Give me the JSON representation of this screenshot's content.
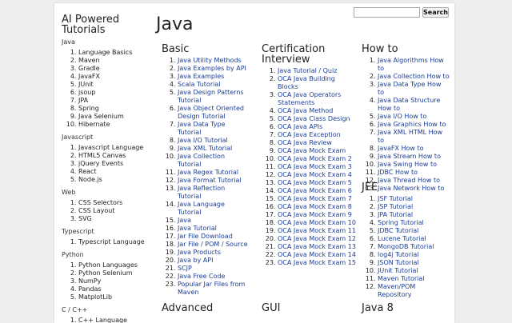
{
  "site_title": "AI Powered Tutorials",
  "page_title": "Java",
  "search": {
    "placeholder": "",
    "button_label": "Search"
  },
  "sidebar": {
    "sections": [
      {
        "title": "Java",
        "items": [
          "Language Basics",
          "Maven",
          "Gradle",
          "JavaFX",
          "JUnit",
          "jsoup",
          "JPA",
          "Spring",
          "Java Selenium",
          "Hibernate"
        ]
      },
      {
        "title": "Javascript",
        "items": [
          "Javascript Language",
          "HTML5 Canvas",
          "jQuery Events",
          "React",
          "Node.js"
        ]
      },
      {
        "title": "Web",
        "items": [
          "CSS Selectors",
          "CSS Layout",
          "SVG"
        ]
      },
      {
        "title": "Typescript",
        "items": [
          "Typescript Language"
        ]
      },
      {
        "title": "Python",
        "items": [
          "Python Languages",
          "Python Selenium",
          "NumPy",
          "Pandas",
          "MatplotLib"
        ]
      },
      {
        "title": "C / C++",
        "items": [
          "C++ Language"
        ]
      }
    ]
  },
  "main": {
    "basic": {
      "title": "Basic",
      "items": [
        "Java Utility Methods",
        "Java Examples by API",
        "Java Examples",
        "Scala Tutorial",
        "Java Design Patterns Tutorial",
        "Java Object Oriented Design Tutorial",
        "Java Data Type Tutorial",
        "Java I/O Tutorial",
        "Java XML Tutorial",
        "Java Collection Tutorial",
        "Java Regex Tutorial",
        "Java Format Tutorial",
        "Java Reflection Tutorial",
        "Java Language Tutorial",
        "Java",
        "Java Tutorial",
        "Jar File Download",
        "Jar File / POM / Source",
        "Java Products",
        "Java by API",
        "SCJP",
        "Java Free Code",
        "Popular Jar Files from Maven"
      ]
    },
    "certification": {
      "title": "Certification Interview",
      "items": [
        "Java Tutorial / Quiz",
        "OCA Java Building Blocks",
        "OCA Java Operators Statements",
        "OCA Java Method",
        "OCA Java Class Design",
        "OCA Java APIs",
        "OCA Java Exception",
        "OCA Java Review",
        "OCA Java Mock Exam",
        "OCA Java Mock Exam 2",
        "OCA Java Mock Exam 3",
        "OCA Java Mock Exam 4",
        "OCA Java Mock Exam 5",
        "OCA Java Mock Exam 6",
        "OCA Java Mock Exam 7",
        "OCA Java Mock Exam 8",
        "OCA Java Mock Exam 9",
        "OCA Java Mock Exam 10",
        "OCA Java Mock Exam 11",
        "OCA Java Mock Exam 12",
        "OCA Java Mock Exam 13",
        "OCA Java Mock Exam 14",
        "OCA Java Mock Exam 15"
      ]
    },
    "howto": {
      "title": "How to",
      "items": [
        "Java Algorithms How to",
        "Java Collection How to",
        "Java Data Type How to",
        "Java Data Structure How to",
        "Java I/O How to",
        "Java Graphics How to",
        "Java XML HTML How to",
        "JavaFX How to",
        "Java Stream How to",
        "Java Swing How to",
        "JDBC How to",
        "Java Thread How to",
        "Java Network How to"
      ]
    },
    "jee": {
      "title": "JEE",
      "items": [
        "JSF Tutorial",
        "JSP Tutorial",
        "JPA Tutorial",
        "Spring Tutorial",
        "JDBC Tutorial",
        "Lucene Tutorial",
        "MongoDB Tutorial",
        "log4j Tutorial",
        "JSON Tutorial",
        "JUnit Tutorial",
        "Maven Tutorial",
        "Maven/POM Repository"
      ]
    },
    "advanced": {
      "title": "Advanced"
    },
    "gui": {
      "title": "GUI"
    },
    "java8": {
      "title": "Java 8"
    }
  }
}
